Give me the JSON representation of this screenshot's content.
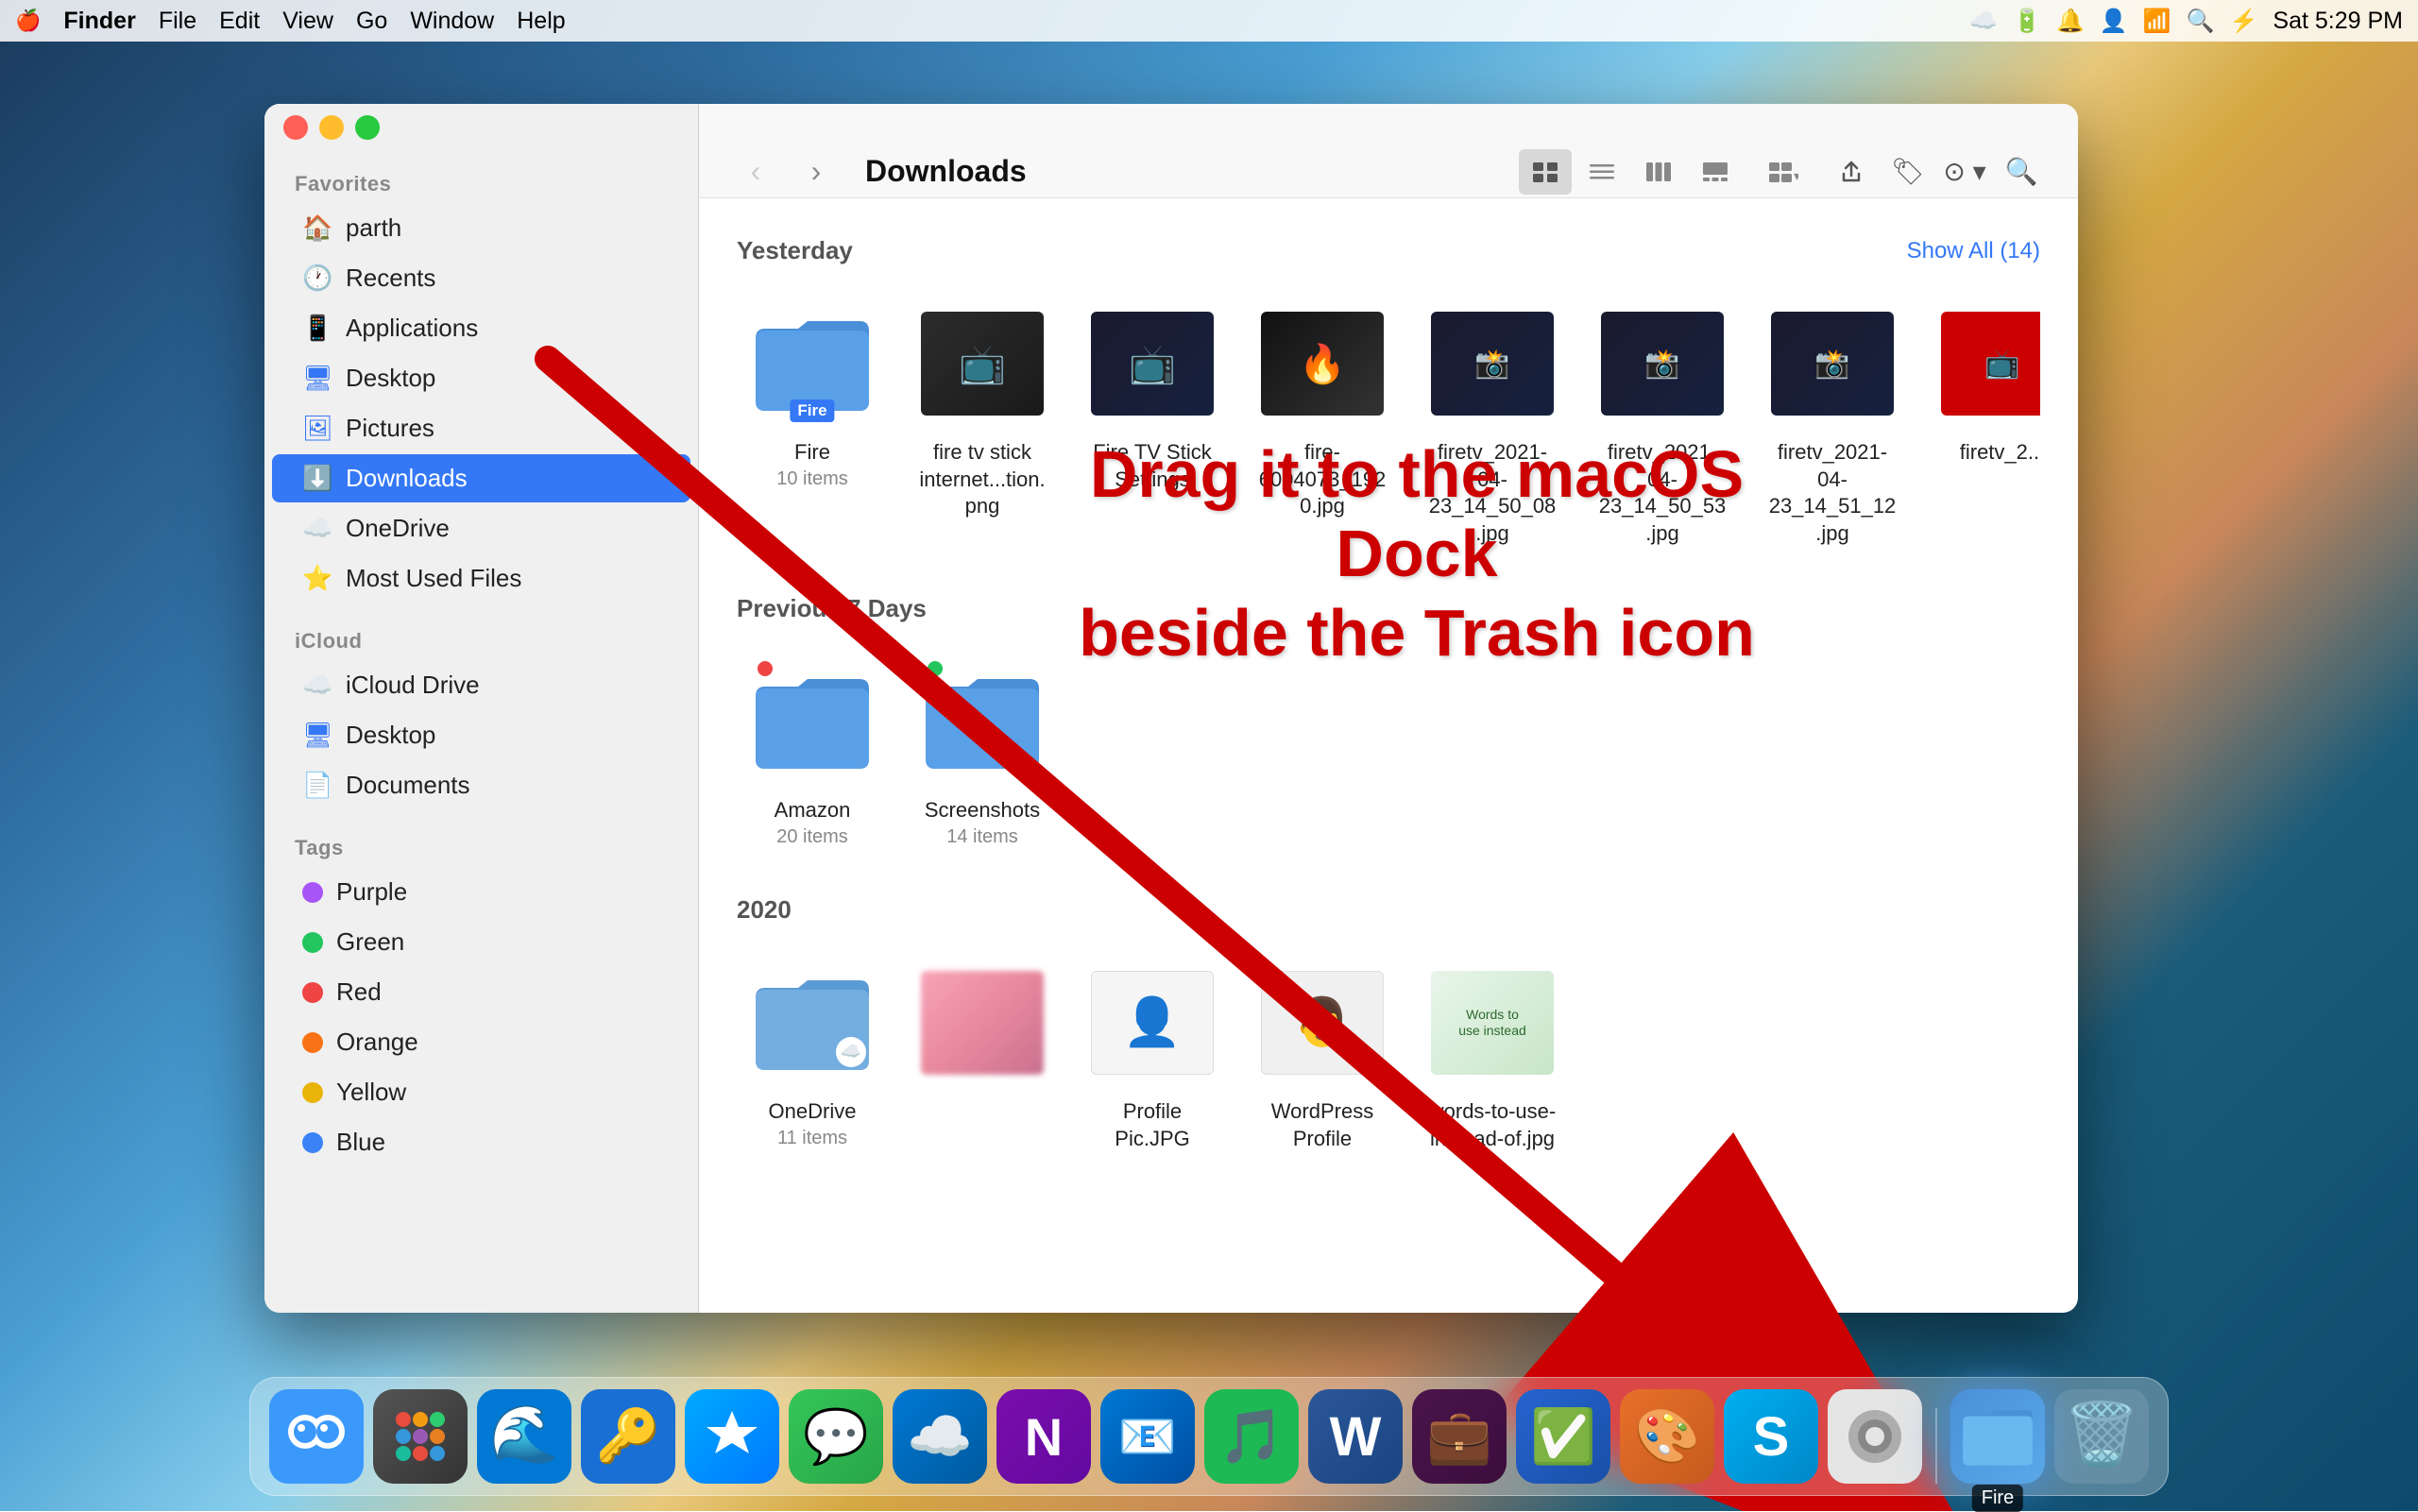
{
  "menubar": {
    "apple": "🍎",
    "items": [
      "Finder",
      "File",
      "Edit",
      "View",
      "Go",
      "Window",
      "Help"
    ],
    "finder_bold": true,
    "right_time": "Sat 5:29 PM"
  },
  "finder": {
    "title": "Downloads",
    "sections": {
      "yesterday": {
        "label": "Yesterday",
        "show_all": "Show All (14)",
        "files": [
          {
            "name": "Fire",
            "subtitle": "10 items",
            "type": "folder",
            "badge": "Fire"
          },
          {
            "name": "fire tv stick internet...tion.png",
            "subtitle": "",
            "type": "image_dark"
          },
          {
            "name": "Fire TV Stick Settings",
            "subtitle": "",
            "type": "image_dark"
          },
          {
            "name": "fire-6004073_1920.jpg",
            "subtitle": "",
            "type": "image_dark"
          },
          {
            "name": "firetv_2021-04-23_14_50_08.jpg",
            "subtitle": "",
            "type": "image_dark"
          },
          {
            "name": "firetv_2021-04-23_14_50_53.jpg",
            "subtitle": "",
            "type": "image_dark"
          },
          {
            "name": "firetv_2021-04-23_14_51_12.jpg",
            "subtitle": "",
            "type": "image_dark"
          },
          {
            "name": "firetv_2...",
            "subtitle": "",
            "type": "image_dark_partial"
          }
        ]
      },
      "previous7days": {
        "label": "Previous 7 Days",
        "files": [
          {
            "name": "Amazon",
            "subtitle": "20 items",
            "type": "folder",
            "dot": "red"
          },
          {
            "name": "Screenshots",
            "subtitle": "14 items",
            "type": "folder",
            "dot": "green"
          }
        ]
      },
      "year2020": {
        "label": "2020",
        "files": [
          {
            "name": "OneDrive",
            "subtitle": "11 items",
            "type": "folder_cloud"
          },
          {
            "name": "",
            "subtitle": "",
            "type": "image_blurred"
          },
          {
            "name": "Profile Pic.JPG",
            "subtitle": "",
            "type": "profile"
          },
          {
            "name": "WordPress Profile",
            "subtitle": "",
            "type": "profile2"
          },
          {
            "name": "words-to-use-instead-of.jpg",
            "subtitle": "",
            "type": "words"
          }
        ]
      }
    }
  },
  "sidebar": {
    "favorites_label": "Favorites",
    "icloud_label": "iCloud",
    "tags_label": "Tags",
    "items_favorites": [
      {
        "label": "parth",
        "icon": "🏠"
      },
      {
        "label": "Recents",
        "icon": "🕐"
      },
      {
        "label": "Applications",
        "icon": "📱"
      },
      {
        "label": "Desktop",
        "icon": "🖥"
      },
      {
        "label": "Pictures",
        "icon": "🖼"
      },
      {
        "label": "Downloads",
        "icon": "⬇️",
        "active": true
      },
      {
        "label": "OneDrive",
        "icon": "☁️"
      },
      {
        "label": "Most Used Files",
        "icon": "⭐"
      }
    ],
    "items_icloud": [
      {
        "label": "iCloud Drive",
        "icon": "☁️"
      },
      {
        "label": "Desktop",
        "icon": "🖥"
      },
      {
        "label": "Documents",
        "icon": "📄"
      }
    ],
    "tags": [
      {
        "label": "Purple",
        "color": "#a855f7"
      },
      {
        "label": "Green",
        "color": "#22c55e"
      },
      {
        "label": "Red",
        "color": "#ef4444"
      },
      {
        "label": "Orange",
        "color": "#f97316"
      },
      {
        "label": "Yellow",
        "color": "#eab308"
      },
      {
        "label": "Blue",
        "color": "#3b82f6"
      }
    ]
  },
  "annotation": {
    "line1": "Drag it to the macOS Dock",
    "line2": "beside the Trash icon"
  },
  "dock": {
    "items": [
      {
        "name": "Finder",
        "emoji": "🔵",
        "color": "#2196F3"
      },
      {
        "name": "Launchpad",
        "emoji": "🚀",
        "color": "#f0f0f0"
      },
      {
        "name": "Edge",
        "emoji": "🌊",
        "color": "#0078d4"
      },
      {
        "name": "1Password",
        "emoji": "🔑",
        "color": "#1a6fd4"
      },
      {
        "name": "App Store",
        "emoji": "🅰️",
        "color": "#0d84ff"
      },
      {
        "name": "Messages",
        "emoji": "💬",
        "color": "#34c759"
      },
      {
        "name": "OneDrive",
        "emoji": "☁️",
        "color": "#0078d4"
      },
      {
        "name": "OneNote",
        "emoji": "📓",
        "color": "#7719aa"
      },
      {
        "name": "Outlook",
        "emoji": "📧",
        "color": "#0078d4"
      },
      {
        "name": "Spotify",
        "emoji": "🎵",
        "color": "#1DB954"
      },
      {
        "name": "Word",
        "emoji": "W",
        "color": "#2b579a"
      },
      {
        "name": "Slack",
        "emoji": "💼",
        "color": "#4a154b"
      },
      {
        "name": "Tasks",
        "emoji": "✅",
        "color": "#2564cf"
      },
      {
        "name": "Pixelmator",
        "emoji": "🎨",
        "color": "#e8702a"
      },
      {
        "name": "Skype",
        "emoji": "S",
        "color": "#00aff0"
      },
      {
        "name": "System Prefs",
        "emoji": "⚙️",
        "color": "#888"
      },
      {
        "name": "Fire",
        "emoji": "📁",
        "color": "#4a90d9"
      },
      {
        "name": "Trash",
        "emoji": "🗑️",
        "color": "#aaa"
      }
    ],
    "fire_label": "Fire"
  }
}
